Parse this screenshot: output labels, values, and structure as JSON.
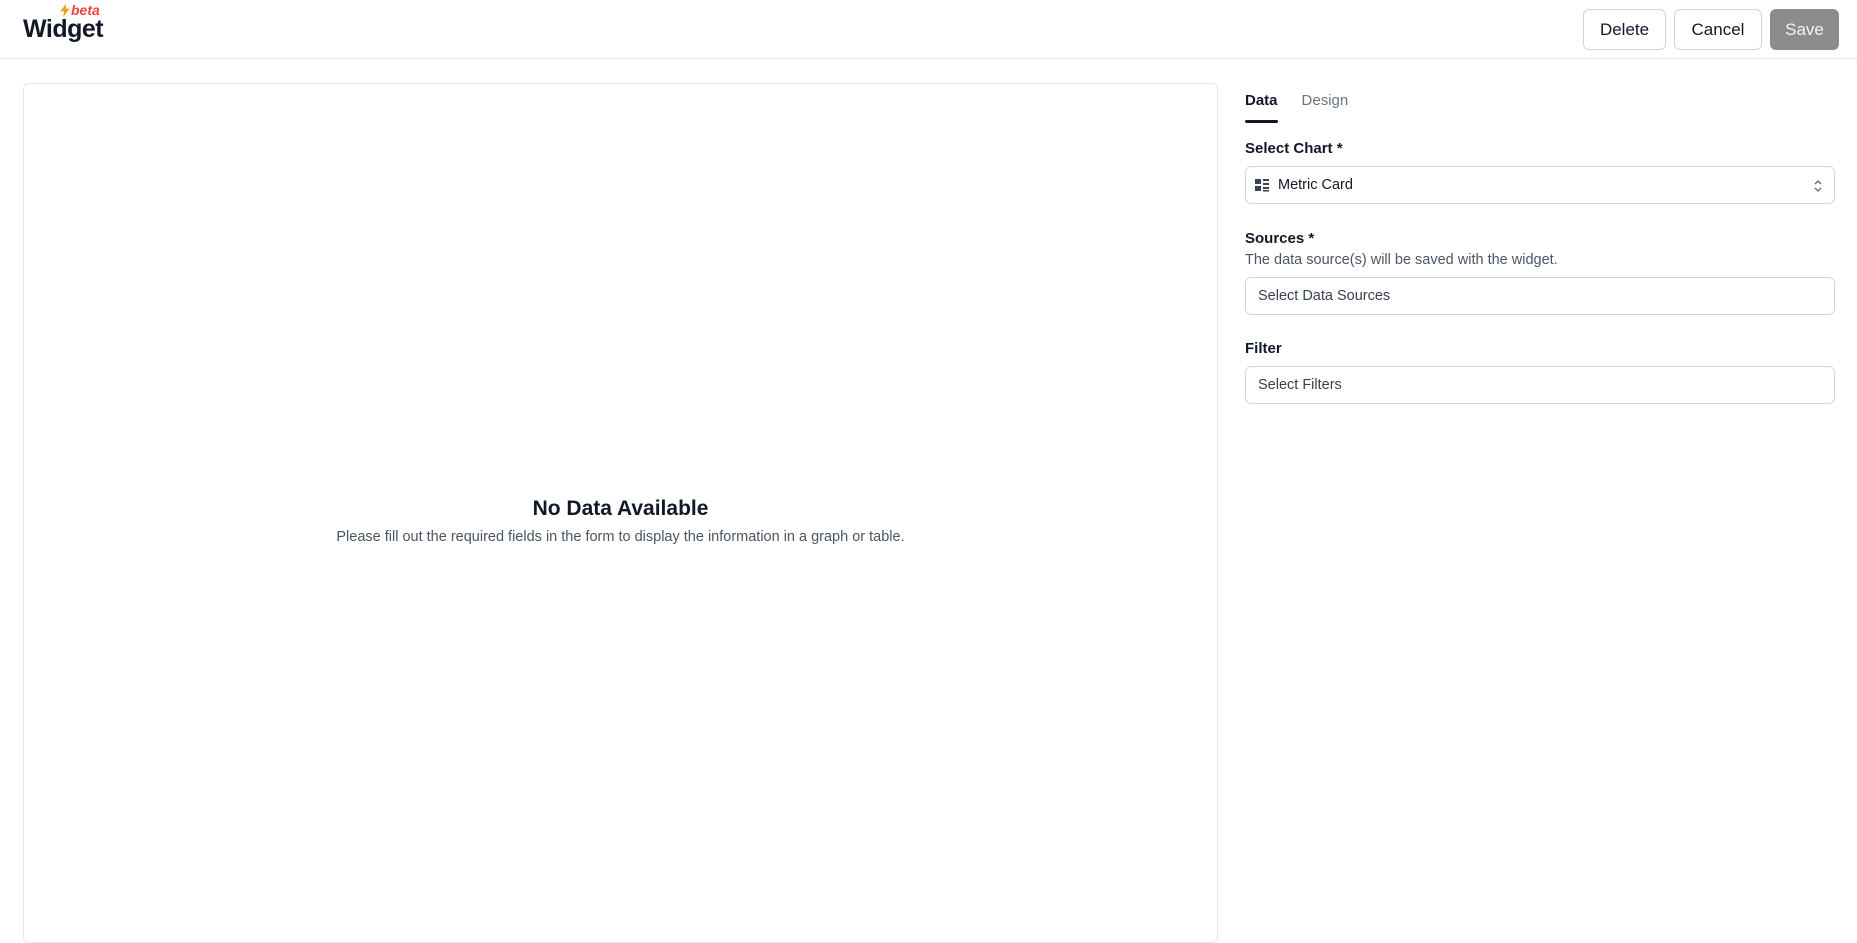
{
  "header": {
    "title": "Widget",
    "badge": "beta",
    "delete_label": "Delete",
    "cancel_label": "Cancel",
    "save_label": "Save"
  },
  "preview": {
    "empty_title": "No Data Available",
    "empty_message": "Please fill out the required fields in the form to display the information in a graph or table."
  },
  "panel": {
    "tabs": [
      {
        "label": "Data",
        "active": true
      },
      {
        "label": "Design",
        "active": false
      }
    ],
    "chart": {
      "label": "Select Chart *",
      "value": "Metric Card",
      "icon": "metric-card-icon"
    },
    "sources": {
      "label": "Sources *",
      "help": "The data source(s) will be saved with the widget.",
      "placeholder": "Select Data Sources"
    },
    "filter": {
      "label": "Filter",
      "placeholder": "Select Filters"
    }
  },
  "colors": {
    "badge": "#ef4444",
    "save_disabled": "#8c8c8c",
    "border": "#d1d5db"
  }
}
